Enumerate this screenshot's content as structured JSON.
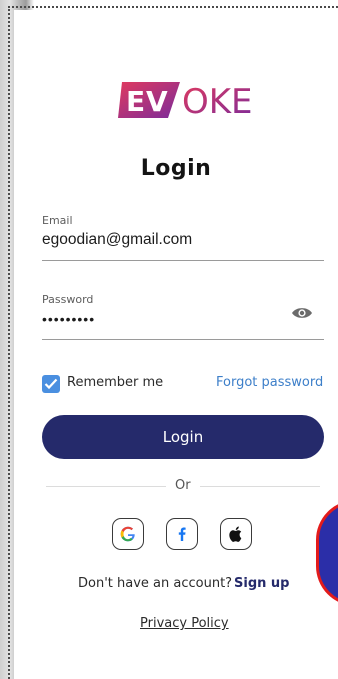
{
  "app": {
    "logo_text": "EVOKE"
  },
  "login": {
    "title": "Login",
    "email_label": "Email",
    "email_value": "egoodian@gmail.com",
    "password_label": "Password",
    "password_value": "•••••••••",
    "remember_label": "Remember me",
    "remember_checked": true,
    "forgot_label": "Forgot password",
    "button_label": "Login",
    "divider_label": "Or",
    "signup_prompt": "Don't have an account?",
    "signup_label": "Sign up",
    "privacy_label": "Privacy Policy"
  },
  "social": [
    {
      "name": "google",
      "icon": "google-icon"
    },
    {
      "name": "facebook",
      "icon": "facebook-icon"
    },
    {
      "name": "apple",
      "icon": "apple-icon"
    }
  ],
  "colors": {
    "primary": "#252A6B",
    "link": "#3D7FC9",
    "checkbox": "#4A8FE0",
    "logo_gradient_start": "#E03A5F",
    "logo_gradient_end": "#7A2B9B",
    "fab_fill": "#2B2EA8",
    "fab_border": "#E31B1B"
  }
}
